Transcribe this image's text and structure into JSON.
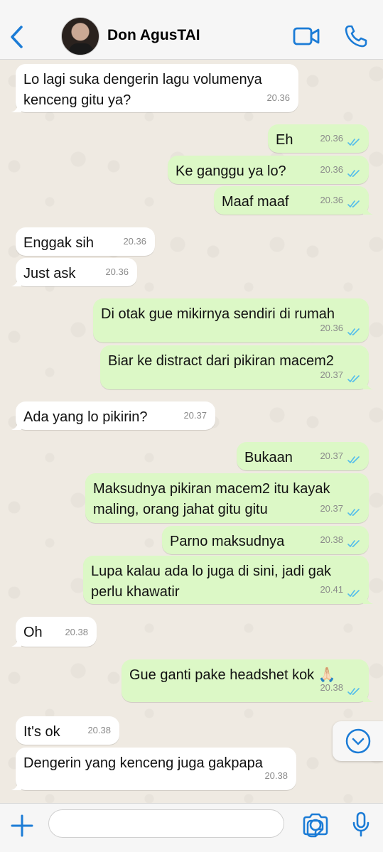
{
  "header": {
    "contact_name": "Don AgusTAI",
    "back_icon": "chevron-left-icon",
    "video_icon": "video-camera-icon",
    "call_icon": "phone-icon"
  },
  "colors": {
    "accent": "#1c7cd6",
    "incoming_bubble": "#ffffff",
    "outgoing_bubble": "#dcf8c6",
    "read_ticks": "#53bdeb"
  },
  "messages": [
    {
      "dir": "in",
      "text": "Lo lagi suka dengerin lagu volumenya\nkenceng gitu ya?",
      "time": "20.36"
    },
    {
      "dir": "out",
      "text": "Eh",
      "time": "20.36"
    },
    {
      "dir": "out",
      "text": "Ke ganggu ya lo?",
      "time": "20.36"
    },
    {
      "dir": "out",
      "text": "Maaf maaf",
      "time": "20.36"
    },
    {
      "dir": "in",
      "text": "Enggak sih",
      "time": "20.36"
    },
    {
      "dir": "in",
      "text": "Just ask",
      "time": "20.36"
    },
    {
      "dir": "out",
      "text": "Di otak gue mikirnya sendiri di rumah",
      "time": "20.36"
    },
    {
      "dir": "out",
      "text": "Biar ke distract dari pikiran macem2",
      "time": "20.37"
    },
    {
      "dir": "in",
      "text": "Ada yang lo pikirin?",
      "time": "20.37"
    },
    {
      "dir": "out",
      "text": "Bukaan",
      "time": "20.37"
    },
    {
      "dir": "out",
      "text": "Maksudnya pikiran macem2 itu kayak\nmaling, orang jahat gitu gitu",
      "time": "20.37"
    },
    {
      "dir": "out",
      "text": "Parno maksudnya",
      "time": "20.38"
    },
    {
      "dir": "out",
      "text": "Lupa kalau ada lo juga di sini, jadi gak\nperlu khawatir",
      "time": "20.41"
    },
    {
      "dir": "in",
      "text": "Oh",
      "time": "20.38"
    },
    {
      "dir": "out",
      "text": "Gue ganti pake headshet kok 🙏🏻",
      "time": "20.38"
    },
    {
      "dir": "in",
      "text": "It's ok",
      "time": "20.38"
    },
    {
      "dir": "in",
      "text": "Dengerin yang kenceng juga gakpapa",
      "time": "20.38"
    }
  ],
  "scroll_down_icon": "chevron-down-circle-icon",
  "bottom_bar": {
    "plus_icon": "plus-icon",
    "sticker_icon": "sticker-icon",
    "camera_icon": "camera-icon",
    "mic_icon": "microphone-icon",
    "input_placeholder": ""
  }
}
